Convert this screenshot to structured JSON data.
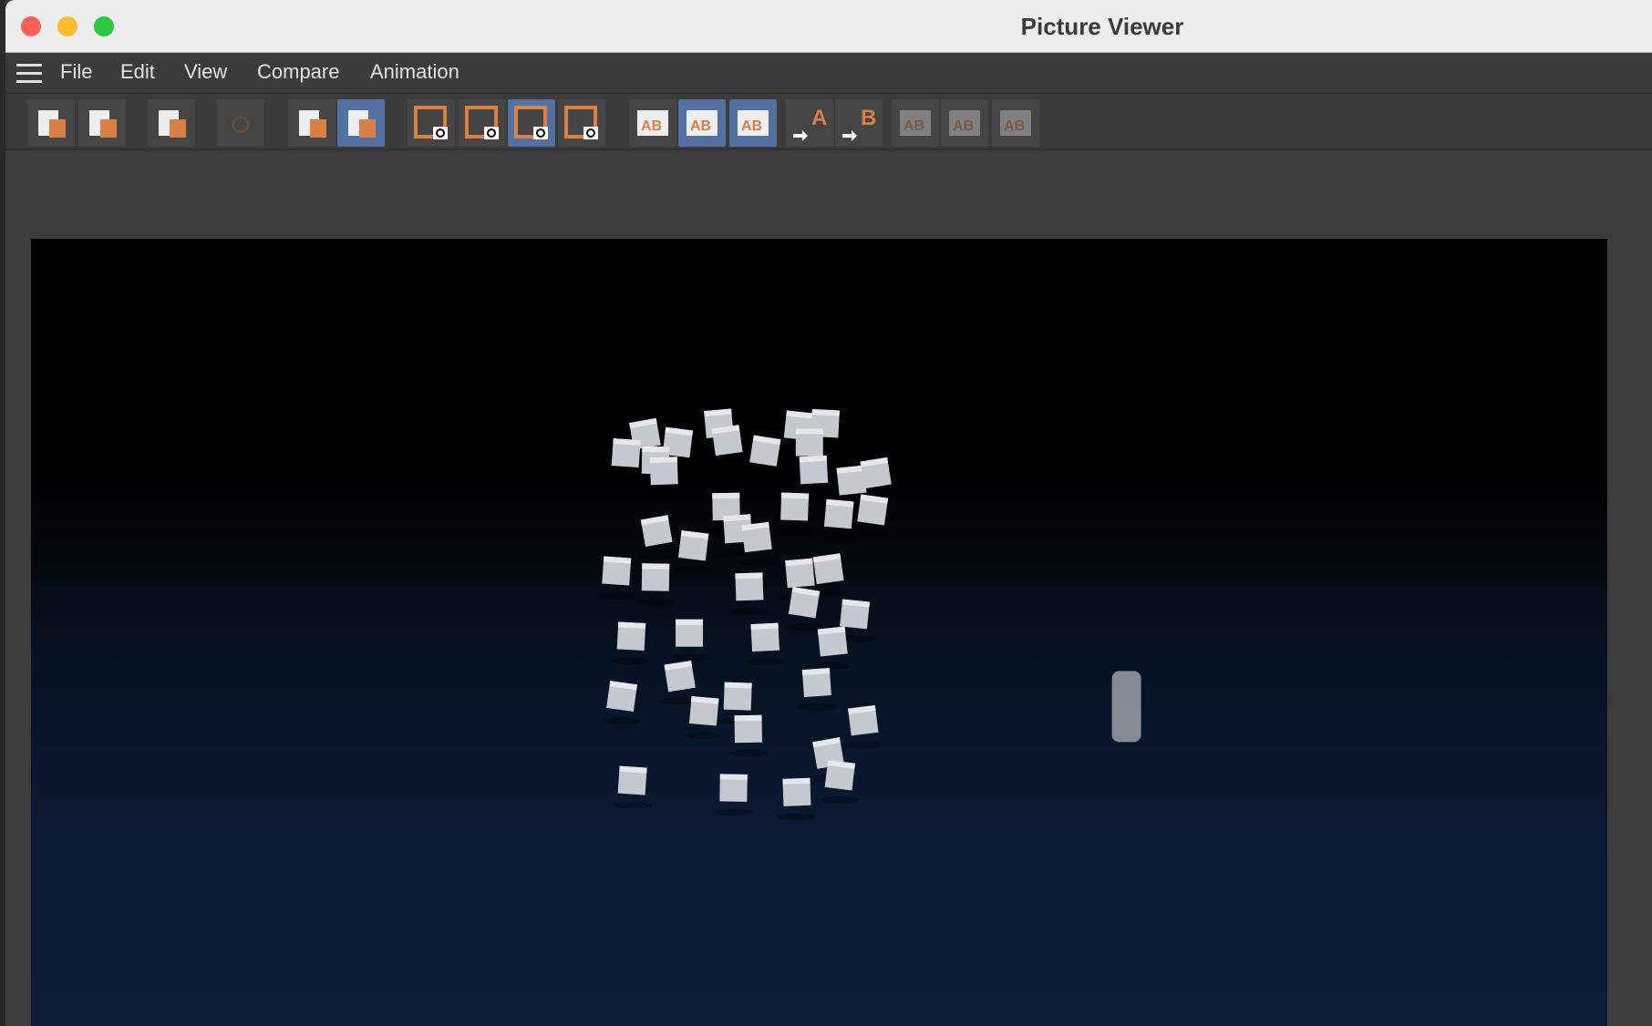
{
  "window": {
    "title": "Picture Viewer",
    "traffic_lights": {
      "close": "#fe5f57",
      "minimize": "#febc2e",
      "zoom": "#28c840"
    }
  },
  "menu": {
    "items": [
      {
        "label": "File"
      },
      {
        "label": "Edit"
      },
      {
        "label": "View"
      },
      {
        "label": "Compare"
      },
      {
        "label": "Animation"
      }
    ]
  },
  "toolbar": {
    "buttons": [
      {
        "name": "open-icon",
        "active": false
      },
      {
        "name": "save-icon",
        "active": false
      },
      {
        "name": "render-animation-icon",
        "active": false
      },
      {
        "name": "stop-render-icon",
        "active": false,
        "disabled": true
      },
      {
        "name": "remove-image-icon",
        "active": false
      },
      {
        "name": "filmstrip-list-icon",
        "active": true
      },
      {
        "name": "view-image-a-icon",
        "active": false
      },
      {
        "name": "view-image-b-icon",
        "active": false
      },
      {
        "name": "view-channels-icon",
        "active": true
      },
      {
        "name": "view-alpha-icon",
        "active": false
      },
      {
        "name": "ab-compare-icon",
        "active": false,
        "label": "AB"
      },
      {
        "name": "ab-view-icon",
        "active": true,
        "label": "AB"
      },
      {
        "name": "ab-overlay-icon",
        "active": true,
        "label": "AB"
      },
      {
        "name": "set-a-icon",
        "active": false,
        "label": "A"
      },
      {
        "name": "set-b-icon",
        "active": false,
        "label": "B"
      },
      {
        "name": "ab-split-vertical-icon",
        "active": false,
        "disabled": true,
        "label": "AB"
      },
      {
        "name": "ab-split-horizontal-icon",
        "active": false,
        "disabled": true,
        "label": "AB"
      },
      {
        "name": "ab-swap-icon",
        "active": false,
        "disabled": true,
        "label": "AB"
      }
    ]
  },
  "colors": {
    "accent": "#d98048",
    "active_button": "#5271a0"
  }
}
